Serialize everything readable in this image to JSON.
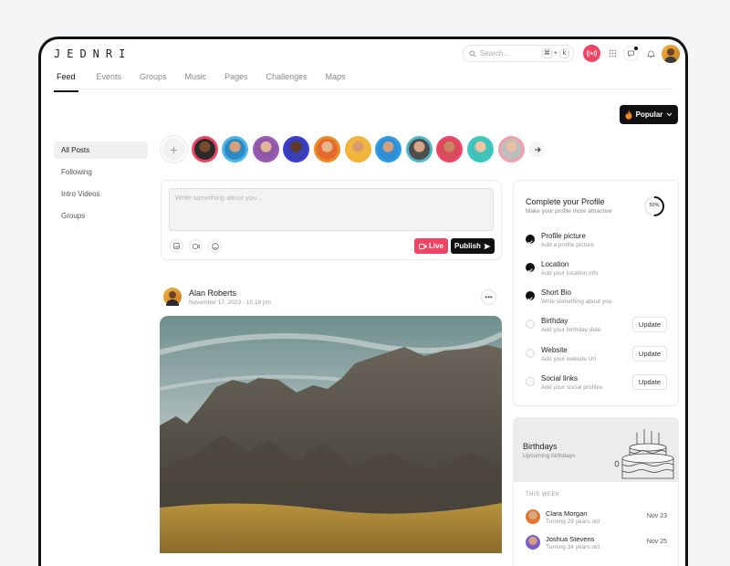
{
  "brand": {
    "logo_text": "JEDNRI"
  },
  "header": {
    "search_placeholder": "Search...",
    "shortcut": [
      "⌘",
      "+",
      "k"
    ],
    "icons": [
      "live-icon",
      "apps-grid-icon",
      "chat-icon",
      "bell-icon",
      "avatar"
    ],
    "live_color": "#ef4565"
  },
  "tabs": [
    {
      "label": "Feed",
      "active": true
    },
    {
      "label": "Events"
    },
    {
      "label": "Groups"
    },
    {
      "label": "Music"
    },
    {
      "label": "Pages"
    },
    {
      "label": "Challenges"
    },
    {
      "label": "Maps"
    }
  ],
  "sort": {
    "label": "Popular",
    "icon": "fire-icon"
  },
  "leftnav": [
    {
      "label": "All Posts",
      "active": true
    },
    {
      "label": "Following"
    },
    {
      "label": "Intro Videos"
    },
    {
      "label": "Groups"
    }
  ],
  "stories": {
    "add_icon": "plus-icon",
    "count": 12,
    "next_icon": "arrow-right-icon"
  },
  "composer": {
    "placeholder": "Write something about you...",
    "icons": [
      "image-icon",
      "video-icon",
      "emoji-icon"
    ],
    "live_label": "Live",
    "publish_label": "Publish"
  },
  "post": {
    "author": "Alan Roberts",
    "date": "November 17, 2023 - 10:18 pm",
    "more_icon": "ellipsis-icon"
  },
  "profile": {
    "title": "Complete your Profile",
    "subtitle": "Make your profile more attractive",
    "progress_label": "50%",
    "progress": 0.5,
    "items": [
      {
        "label": "Profile picture",
        "hint": "Add a profile picture",
        "done": true
      },
      {
        "label": "Location",
        "hint": "Add your location info",
        "done": true
      },
      {
        "label": "Short Bio",
        "hint": "Write something about you",
        "done": true
      },
      {
        "label": "Birthday",
        "hint": "Add your birthday date",
        "done": false,
        "button": "Update"
      },
      {
        "label": "Website",
        "hint": "Add your website Url",
        "done": false,
        "button": "Update"
      },
      {
        "label": "Social links",
        "hint": "Add your social profiles",
        "done": false,
        "button": "Update"
      }
    ]
  },
  "birthdays": {
    "title": "Birthdays",
    "subtitle": "Upcoming birthdays",
    "section_label": "THIS WEEK",
    "people": [
      {
        "name": "Clara Morgan",
        "hint": "Turning 28 years old",
        "date": "Nov 23"
      },
      {
        "name": "Joshua Stevens",
        "hint": "Turning 34 years old",
        "date": "Nov 25"
      }
    ]
  }
}
